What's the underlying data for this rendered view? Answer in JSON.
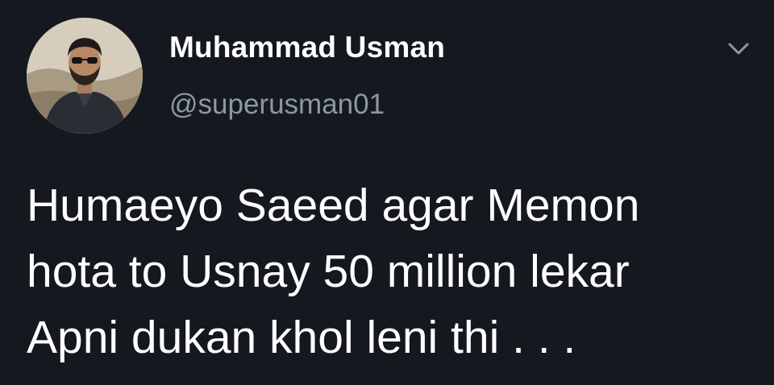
{
  "author": {
    "display_name": "Muhammad Usman",
    "handle": "@superusman01",
    "avatar_icon": "profile-photo"
  },
  "tweet": {
    "text": "Humaeyo Saeed agar Memon\nhota to Usnay 50 million lekar\nApni dukan khol leni thi . . ."
  },
  "menu": {
    "icon": "chevron-down-icon"
  },
  "colors": {
    "background": "#15181f",
    "primary_text": "#ffffff",
    "secondary_text": "#8b98a5",
    "caret": "#8b98a5"
  }
}
